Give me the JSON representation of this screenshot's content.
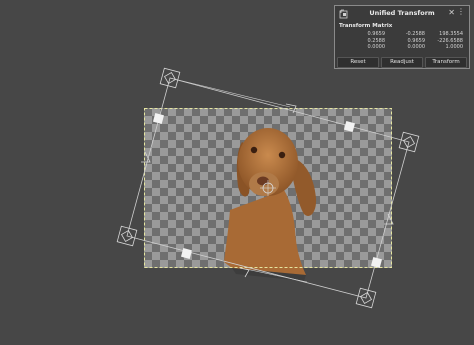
{
  "dialog": {
    "title": "Unified Transform",
    "icon": "transform-tool-icon",
    "close_glyph": "✕",
    "menu_glyph": "⋮",
    "matrix_heading": "Transform Matrix",
    "matrix": [
      [
        "0.9659",
        "-0.2588",
        "198.3554"
      ],
      [
        "0.2588",
        "0.9659",
        "-226.6588"
      ],
      [
        "0.0000",
        "0.0000",
        "1.0000"
      ]
    ],
    "buttons": {
      "reset": "Reset",
      "readjust": "Readjust",
      "transform": "Transform"
    }
  },
  "canvas": {
    "background": "#474747",
    "checker_light": "#9a9a9a",
    "checker_dark": "#6f6f6f",
    "selection_color": "#e6e6a0",
    "layer_image": "dog-photo"
  }
}
